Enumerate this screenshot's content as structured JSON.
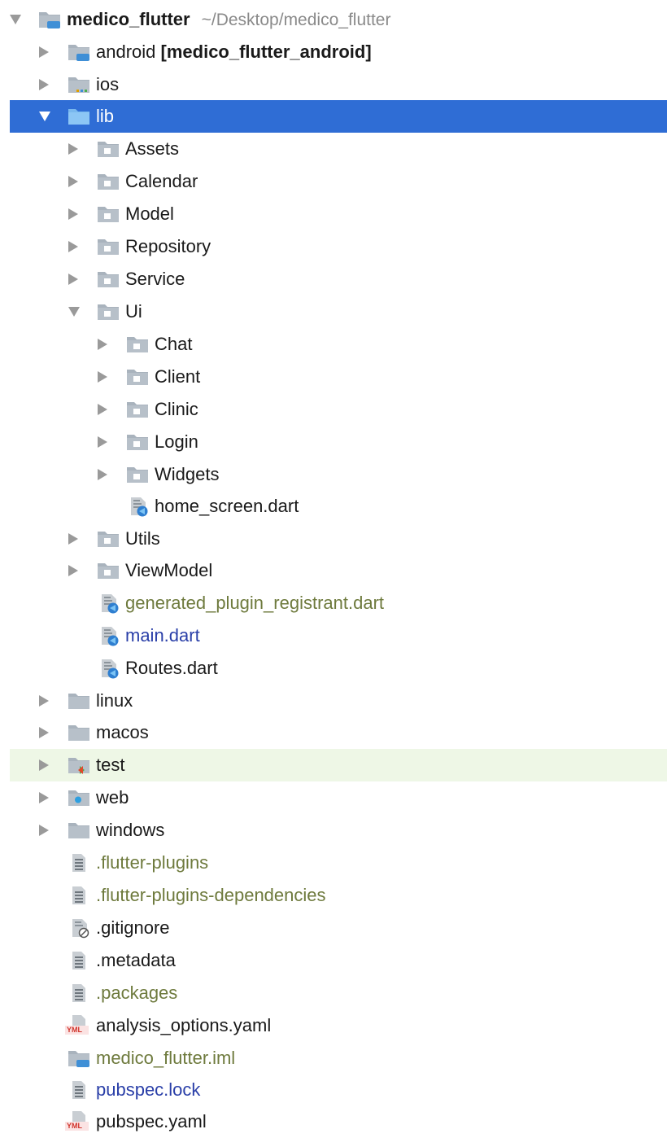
{
  "root": {
    "name": "medico_flutter",
    "path": "~/Desktop/medico_flutter"
  },
  "items": {
    "android": {
      "name": "android",
      "module": "[medico_flutter_android]"
    },
    "ios": "ios",
    "lib": "lib",
    "assets": "Assets",
    "calendar": "Calendar",
    "model": "Model",
    "repository": "Repository",
    "service": "Service",
    "ui": "Ui",
    "chat": "Chat",
    "client": "Client",
    "clinic": "Clinic",
    "login": "Login",
    "widgets": "Widgets",
    "home_screen": "home_screen.dart",
    "utils": "Utils",
    "viewmodel": "ViewModel",
    "generated_plugin": "generated_plugin_registrant.dart",
    "main": "main.dart",
    "routes": "Routes.dart",
    "linux": "linux",
    "macos": "macos",
    "test": "test",
    "web": "web",
    "windows": "windows",
    "flutter_plugins": ".flutter-plugins",
    "flutter_plugins_deps": ".flutter-plugins-dependencies",
    "gitignore": ".gitignore",
    "metadata": ".metadata",
    "packages": ".packages",
    "analysis_options": "analysis_options.yaml",
    "iml": "medico_flutter.iml",
    "pubspec_lock": "pubspec.lock",
    "pubspec_yaml": "pubspec.yaml"
  },
  "icons": {
    "yml_badge": "YML"
  },
  "colors": {
    "selection": "#2f6dd5",
    "test_highlight": "#eef7e6",
    "olive_text": "#6e7a3d",
    "blue_text": "#2a3fa8"
  }
}
